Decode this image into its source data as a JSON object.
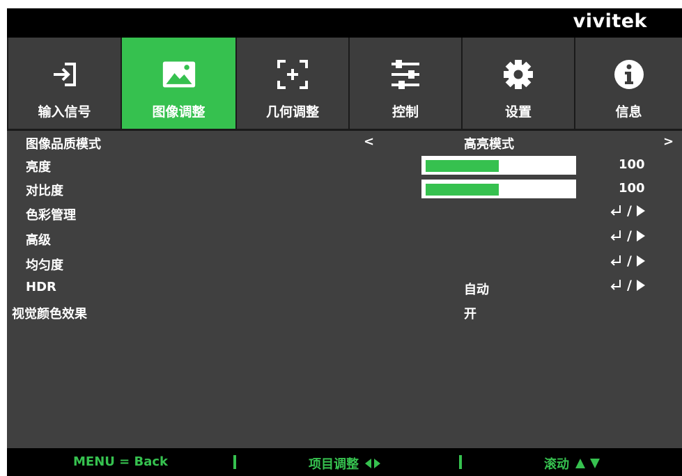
{
  "brand": "vivitek",
  "tabs": [
    {
      "label": "输入信号",
      "icon": "input-icon",
      "active": false
    },
    {
      "label": "图像调整",
      "icon": "picture-icon",
      "active": true
    },
    {
      "label": "几何调整",
      "icon": "geometry-icon",
      "active": false
    },
    {
      "label": "控制",
      "icon": "sliders-icon",
      "active": false
    },
    {
      "label": "设置",
      "icon": "gear-icon",
      "active": false
    },
    {
      "label": "信息",
      "icon": "info-icon",
      "active": false
    }
  ],
  "menu": {
    "picture_mode": {
      "label": "图像品质模式",
      "prev": "<",
      "value": "高亮模式",
      "next": ">"
    },
    "brightness": {
      "label": "亮度",
      "value": "100",
      "level": 0.48
    },
    "contrast": {
      "label": "对比度",
      "value": "100",
      "level": 0.48
    },
    "color_management": {
      "label": "色彩管理",
      "slash": "/"
    },
    "advanced": {
      "label": "高级",
      "slash": "/"
    },
    "uniformity": {
      "label": "均匀度",
      "slash": "/"
    },
    "hdr": {
      "label": "HDR",
      "value": "自动",
      "slash": "/"
    },
    "visual_color_effect": {
      "label": "视觉颜色效果",
      "value": "开"
    }
  },
  "footer": {
    "back": "MENU = Back",
    "adjust": "项目调整",
    "scroll": "滚动"
  },
  "colors": {
    "accent": "#36c14f",
    "panel": "#404040",
    "bar": "#000000"
  }
}
